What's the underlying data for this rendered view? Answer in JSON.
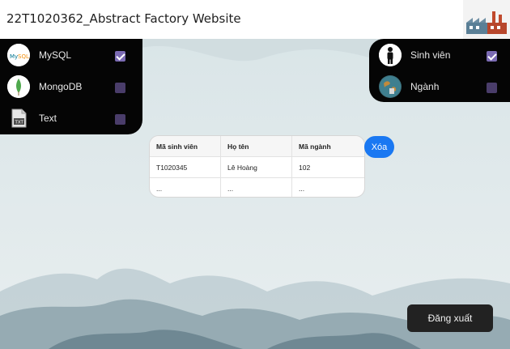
{
  "header": {
    "title": "22T1020362_Abstract Factory Website",
    "logo_icon": "factory-icon"
  },
  "data_sources": {
    "items": [
      {
        "label": "MySQL",
        "icon": "mysql-icon",
        "checked": true
      },
      {
        "label": "MongoDB",
        "icon": "mongodb-icon",
        "checked": false
      },
      {
        "label": "Text",
        "icon": "txt-file-icon",
        "checked": false
      }
    ]
  },
  "entities": {
    "items": [
      {
        "label": "Sinh viên",
        "icon": "person-icon",
        "checked": true
      },
      {
        "label": "Ngành",
        "icon": "globe-icon",
        "checked": false
      }
    ]
  },
  "table": {
    "headers": [
      "Mã sinh viên",
      "Họ tên",
      "Mã ngành"
    ],
    "rows": [
      [
        "T1020345",
        "Lê Hoàng",
        "102"
      ],
      [
        "...",
        "...",
        "..."
      ]
    ]
  },
  "actions": {
    "delete_label": "Xóa",
    "logout_label": "Đăng xuất"
  },
  "colors": {
    "accent_blue": "#1a78f2",
    "checkbox_on": "#7b6bb3",
    "panel_bg": "#050505"
  }
}
